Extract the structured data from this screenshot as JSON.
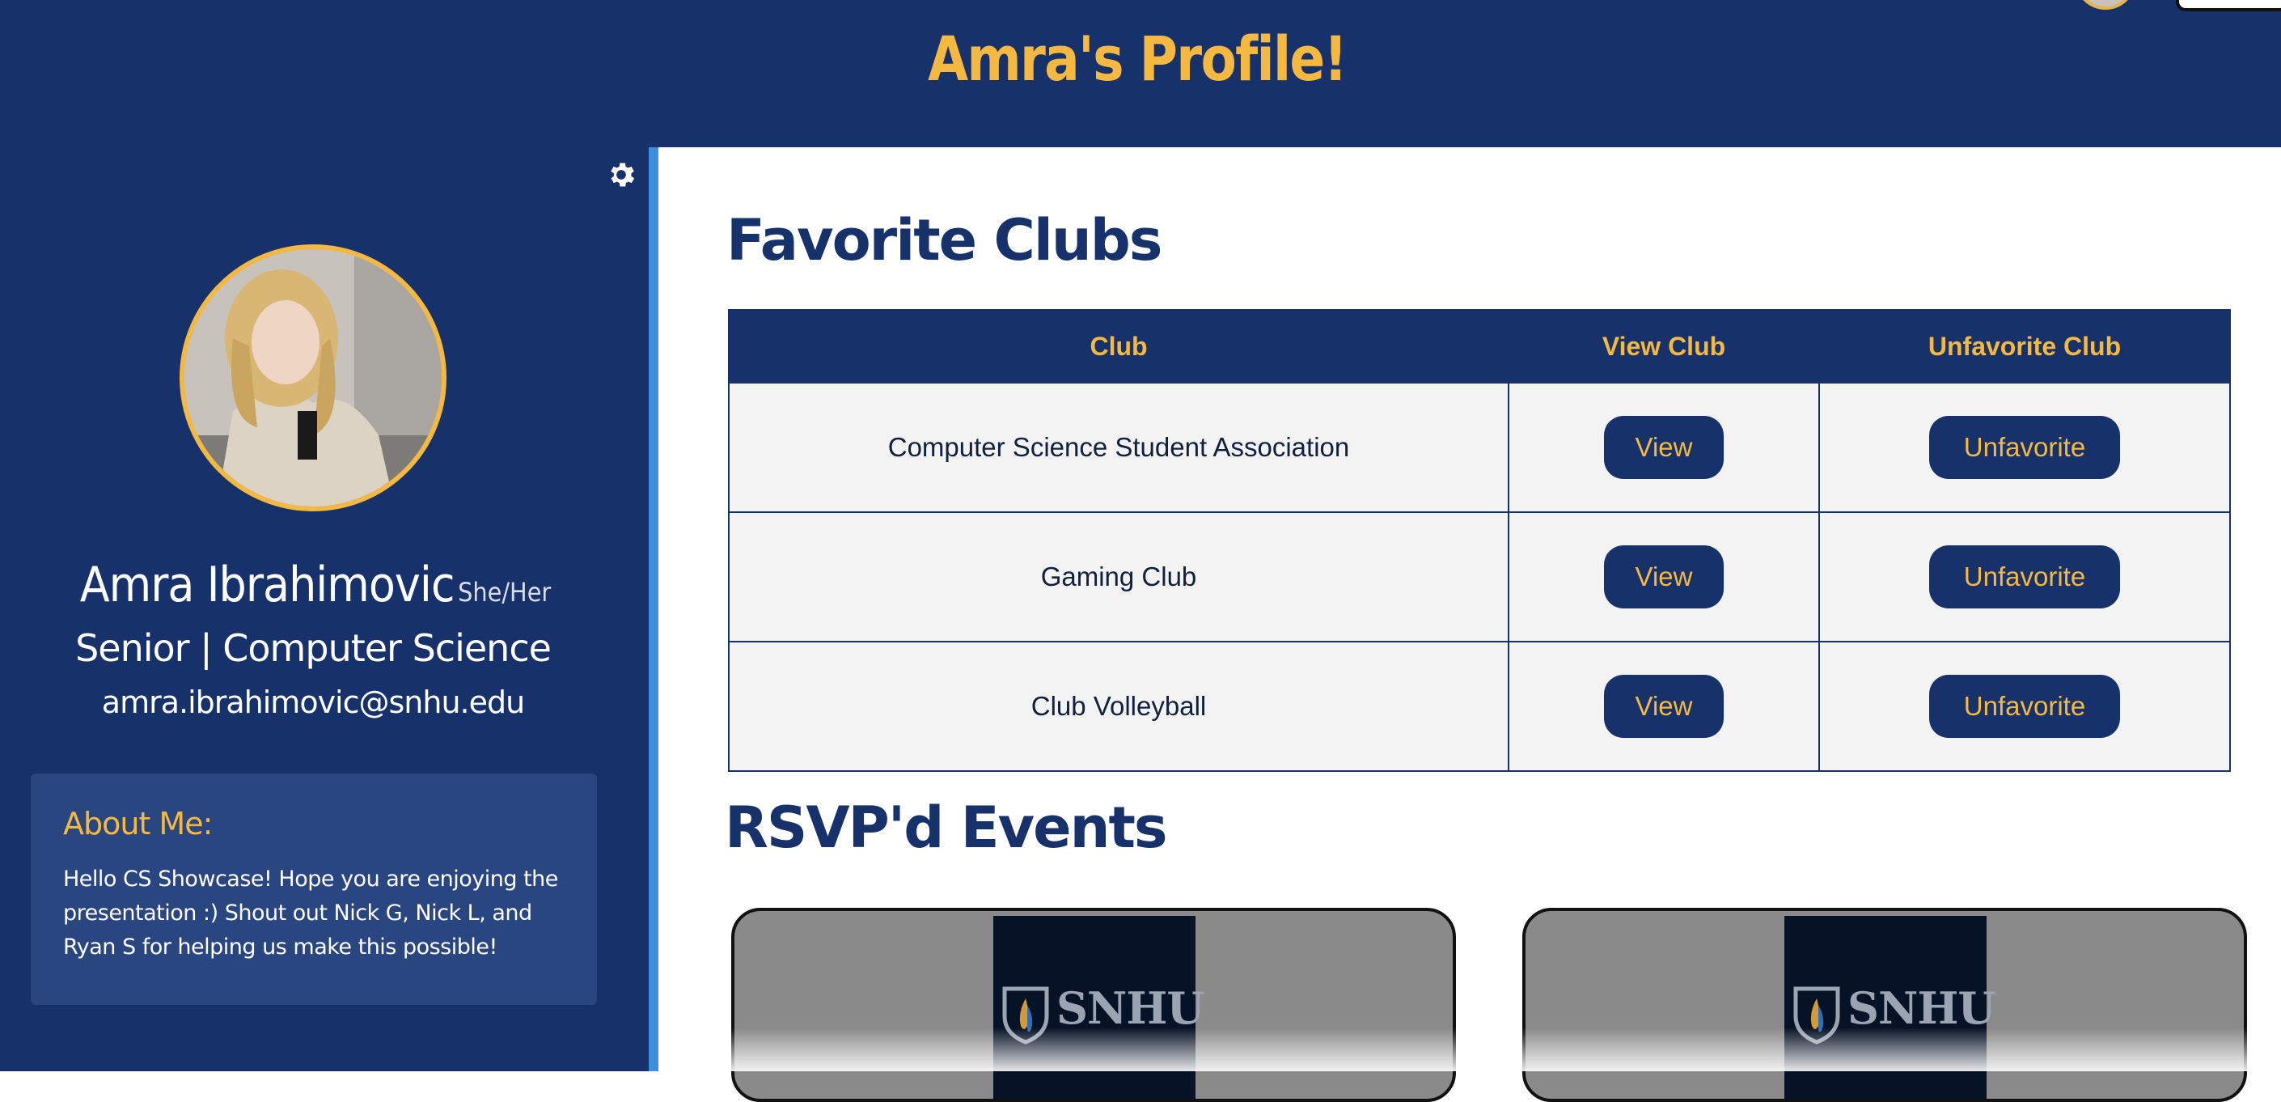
{
  "header": {
    "title": "Amra's Profile!"
  },
  "profile": {
    "name": "Amra Ibrahimovic",
    "pronouns": "She/Her",
    "major": "Senior | Computer Science",
    "email": "amra.ibrahimovic@snhu.edu"
  },
  "about": {
    "title": "About Me:",
    "text": "Hello CS Showcase! Hope you are enjoying the presentation :) Shout out Nick G, Nick L, and Ryan S for helping us make this possible!"
  },
  "favorites": {
    "title": "Favorite Clubs",
    "columns": [
      "Club",
      "View Club",
      "Unfavorite Club"
    ],
    "rows": [
      {
        "club": "Computer Science Student Association",
        "view": "View",
        "unfavorite": "Unfavorite"
      },
      {
        "club": "Gaming Club",
        "view": "View",
        "unfavorite": "Unfavorite"
      },
      {
        "club": "Club Volleyball",
        "view": "View",
        "unfavorite": "Unfavorite"
      }
    ]
  },
  "events": {
    "title": "RSVP'd Events",
    "cards": [
      {
        "logo_text": "SNHU"
      },
      {
        "logo_text": "SNHU"
      }
    ]
  },
  "colors": {
    "navy": "#17326b",
    "gold": "#f5b942",
    "accent_blue": "#3d8fdd",
    "about_bg": "#2a4680",
    "row_bg": "#f3f3f3"
  },
  "icons": [
    "gear-icon",
    "snhu-flame-icon"
  ]
}
